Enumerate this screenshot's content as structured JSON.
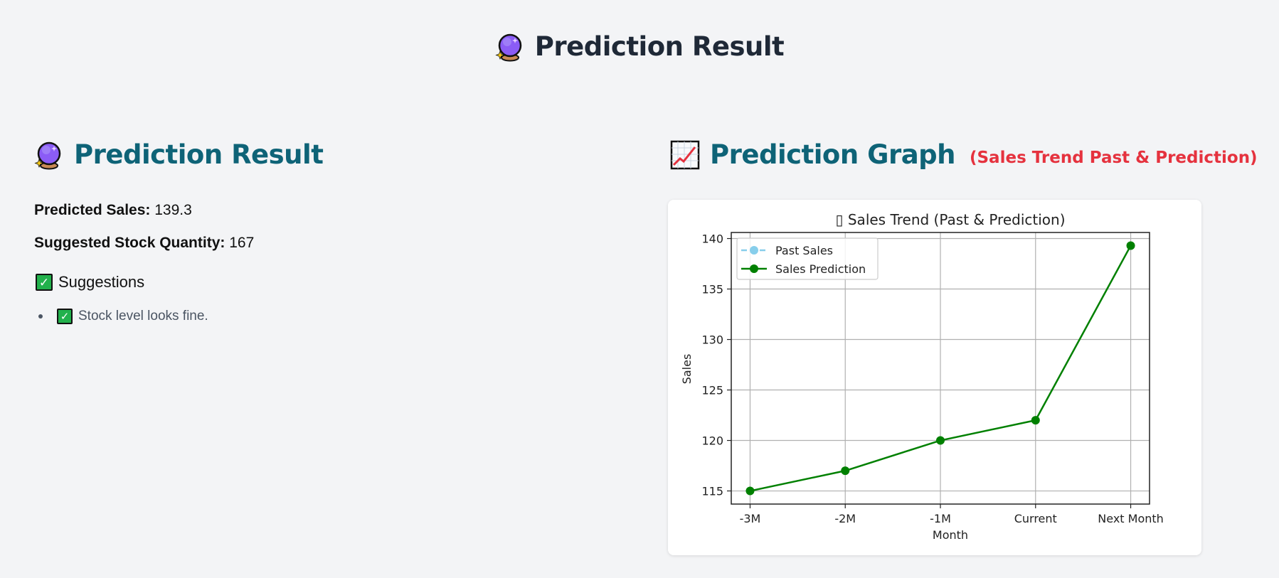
{
  "page": {
    "title": "Prediction Result"
  },
  "result": {
    "title": "Prediction Result",
    "predicted_sales_label": "Predicted Sales:",
    "predicted_sales_value": "139.3",
    "stock_label": "Suggested Stock Quantity:",
    "stock_value": "167",
    "suggestions_title": "Suggestions",
    "suggestions": [
      {
        "icon": "check-mark-icon",
        "text": "Stock level looks fine."
      }
    ]
  },
  "graph": {
    "title": "Prediction Graph",
    "subtitle": "(Sales Trend Past & Prediction)"
  },
  "colors": {
    "heading_dark": "#1f2937",
    "heading_teal": "#0e6377",
    "subtitle_red": "#e5323e",
    "prediction_line": "#008000",
    "past_line": "#87ceeb",
    "check_green": "#22b14c"
  },
  "chart_data": {
    "type": "line",
    "title": "▯ Sales Trend (Past & Prediction)",
    "xlabel": "Month",
    "ylabel": "Sales",
    "categories": [
      "-3M",
      "-2M",
      "-1M",
      "Current",
      "Next Month"
    ],
    "series": [
      {
        "name": "Past Sales",
        "values": [],
        "color": "#87ceeb",
        "style": "dashed"
      },
      {
        "name": "Sales Prediction",
        "values": [
          115,
          117,
          120,
          122,
          139.3
        ],
        "color": "#008000",
        "style": "solid"
      }
    ],
    "yticks": [
      115,
      120,
      125,
      130,
      135,
      140
    ],
    "ylim": [
      113.7,
      140.6
    ],
    "grid": true,
    "legend": "top-left"
  }
}
